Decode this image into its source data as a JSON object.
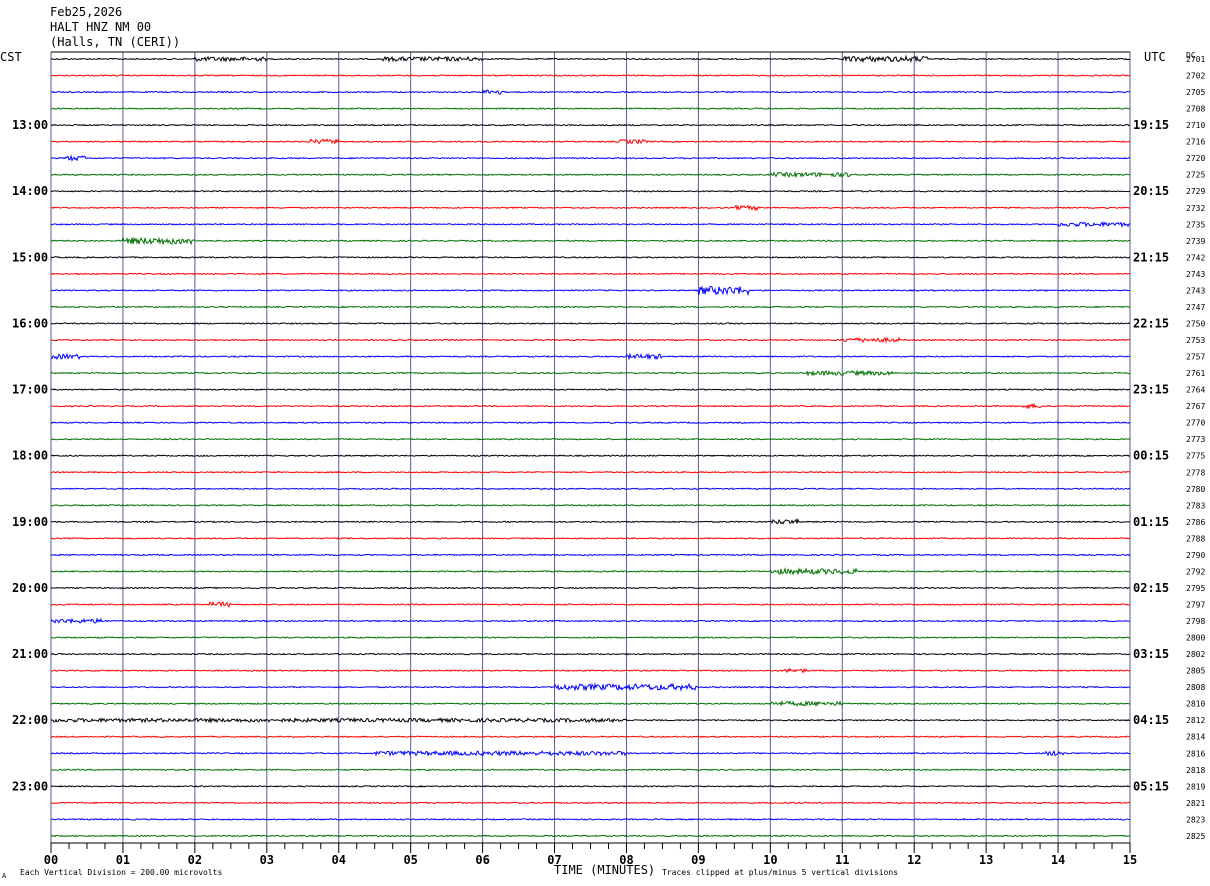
{
  "header": {
    "date": "Feb25,2026",
    "station": "HALT HNZ NM 00",
    "location": "(Halls, TN (CERI))"
  },
  "left_axis_label": "CST",
  "right_axis_label": "UTC",
  "dc_label": "DC",
  "footer": {
    "corner_mark": "A",
    "scale_note": "Each Vertical Division =  200.00 microvolts",
    "clip_note": "Traces clipped at plus/minus 5 vertical divisions"
  },
  "colors": {
    "trace_cycle": [
      "#000000",
      "#ff0000",
      "#0000ff",
      "#007000"
    ],
    "grid_vertical": "#5a5a96",
    "axis": "#000000"
  },
  "chart_data": {
    "type": "line",
    "xlabel": "TIME (MINUTES)",
    "x_ticks": [
      "00",
      "01",
      "02",
      "03",
      "04",
      "05",
      "06",
      "07",
      "08",
      "09",
      "10",
      "11",
      "12",
      "13",
      "14",
      "15"
    ],
    "xlim": [
      0,
      15
    ],
    "trace_duration_minutes": 15,
    "traces_per_hour": 4,
    "left_hour_labels": [
      "13:00",
      "14:00",
      "15:00",
      "16:00",
      "17:00",
      "18:00",
      "19:00",
      "20:00",
      "21:00",
      "22:00",
      "23:00"
    ],
    "right_hour_labels": [
      "19:15",
      "20:15",
      "21:15",
      "22:15",
      "23:15",
      "00:15",
      "01:15",
      "02:15",
      "03:15",
      "04:15",
      "05:15"
    ],
    "dc_offsets": [
      "2701",
      "2702",
      "2705",
      "2708",
      "2710",
      "2716",
      "2720",
      "2725",
      "2729",
      "2732",
      "2735",
      "2739",
      "2742",
      "2743",
      "2743",
      "2747",
      "2750",
      "2753",
      "2757",
      "2761",
      "2764",
      "2767",
      "2770",
      "2773",
      "2775",
      "2778",
      "2780",
      "2783",
      "2786",
      "2788",
      "2790",
      "2792",
      "2795",
      "2797",
      "2798",
      "2800",
      "2802",
      "2805",
      "2808",
      "2810",
      "2812",
      "2814",
      "2816",
      "2818",
      "2819",
      "2821",
      "2823",
      "2825"
    ],
    "events": [
      {
        "trace": 0,
        "start_min": 2.0,
        "end_min": 3.0,
        "amp": 0.5
      },
      {
        "trace": 0,
        "start_min": 4.6,
        "end_min": 6.0,
        "amp": 0.5
      },
      {
        "trace": 0,
        "start_min": 11.0,
        "end_min": 12.2,
        "amp": 0.7
      },
      {
        "trace": 2,
        "start_min": 6.0,
        "end_min": 6.3,
        "amp": 0.6
      },
      {
        "trace": 5,
        "start_min": 3.6,
        "end_min": 4.0,
        "amp": 0.6
      },
      {
        "trace": 5,
        "start_min": 7.9,
        "end_min": 8.3,
        "amp": 0.5
      },
      {
        "trace": 6,
        "start_min": 0.2,
        "end_min": 0.5,
        "amp": 0.6
      },
      {
        "trace": 7,
        "start_min": 10.0,
        "end_min": 11.2,
        "amp": 0.5
      },
      {
        "trace": 9,
        "start_min": 9.5,
        "end_min": 9.9,
        "amp": 0.5
      },
      {
        "trace": 10,
        "start_min": 14.0,
        "end_min": 15.0,
        "amp": 0.5
      },
      {
        "trace": 11,
        "start_min": 1.0,
        "end_min": 2.0,
        "amp": 0.9
      },
      {
        "trace": 14,
        "start_min": 9.0,
        "end_min": 9.7,
        "amp": 1.2
      },
      {
        "trace": 17,
        "start_min": 11.0,
        "end_min": 11.8,
        "amp": 0.5
      },
      {
        "trace": 18,
        "start_min": 0.0,
        "end_min": 0.4,
        "amp": 0.6
      },
      {
        "trace": 18,
        "start_min": 8.0,
        "end_min": 8.5,
        "amp": 0.6
      },
      {
        "trace": 19,
        "start_min": 10.5,
        "end_min": 11.7,
        "amp": 0.5
      },
      {
        "trace": 21,
        "start_min": 13.5,
        "end_min": 13.8,
        "amp": 0.5
      },
      {
        "trace": 28,
        "start_min": 10.0,
        "end_min": 10.4,
        "amp": 0.6
      },
      {
        "trace": 31,
        "start_min": 10.0,
        "end_min": 11.2,
        "amp": 0.7
      },
      {
        "trace": 33,
        "start_min": 2.2,
        "end_min": 2.5,
        "amp": 0.6
      },
      {
        "trace": 34,
        "start_min": 0.0,
        "end_min": 0.8,
        "amp": 0.5
      },
      {
        "trace": 37,
        "start_min": 10.2,
        "end_min": 10.5,
        "amp": 0.5
      },
      {
        "trace": 38,
        "start_min": 7.0,
        "end_min": 9.0,
        "amp": 0.8
      },
      {
        "trace": 39,
        "start_min": 10.0,
        "end_min": 11.0,
        "amp": 0.5
      },
      {
        "trace": 40,
        "start_min": 0.0,
        "end_min": 8.0,
        "amp": 0.4
      },
      {
        "trace": 42,
        "start_min": 4.5,
        "end_min": 8.0,
        "amp": 0.5
      },
      {
        "trace": 42,
        "start_min": 13.8,
        "end_min": 14.1,
        "amp": 0.6
      }
    ],
    "grid": true
  }
}
